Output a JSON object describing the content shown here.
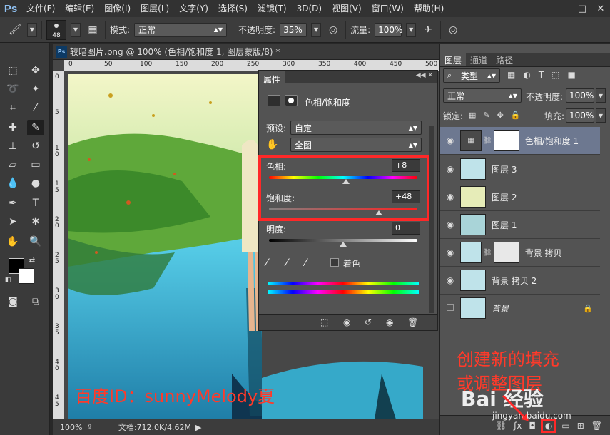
{
  "app": {
    "logo": "Ps"
  },
  "menu": [
    "文件(F)",
    "编辑(E)",
    "图像(I)",
    "图层(L)",
    "文字(Y)",
    "选择(S)",
    "滤镜(T)",
    "3D(D)",
    "视图(V)",
    "窗口(W)",
    "帮助(H)"
  ],
  "window_controls": {
    "minimize": "—",
    "maximize": "□",
    "close": "✕"
  },
  "options": {
    "brush_size": "48",
    "mode_label": "模式:",
    "mode_value": "正常",
    "opacity_label": "不透明度:",
    "opacity_value": "35%",
    "flow_label": "流量:",
    "flow_value": "100%"
  },
  "document": {
    "tab_title": "较暗图片.png @ 100% (色相/饱和度 1, 图层蒙版/8) *",
    "zoom": "100%",
    "doc_info": "文档:712.0K/4.62M",
    "ruler_top": [
      "0",
      "50",
      "100",
      "150",
      "200",
      "250",
      "300",
      "350",
      "400",
      "450",
      "500"
    ],
    "ruler_left": [
      "0",
      "5",
      "1 0",
      "1 5",
      "2 0",
      "2 5",
      "3 0",
      "3 5",
      "4 0",
      "4 5"
    ]
  },
  "properties": {
    "panel_title": "属性",
    "adjustment_name": "色相/饱和度",
    "preset_label": "预设:",
    "preset_value": "自定",
    "channel_value": "全图",
    "hue_label": "色相:",
    "hue_value": "+8",
    "hue_level": 0.52,
    "saturation_label": "饱和度:",
    "saturation_value": "+48",
    "saturation_level": 0.74,
    "lightness_label": "明度:",
    "lightness_value": "0",
    "lightness_level": 0.5,
    "colorize_label": "着色"
  },
  "layers_panel": {
    "tabs": [
      "图层",
      "通道",
      "路径"
    ],
    "filter_value": "类型",
    "blend_mode": "正常",
    "opacity_label": "不透明度:",
    "opacity_value": "100%",
    "lock_label": "锁定:",
    "fill_label": "填充:",
    "fill_value": "100%",
    "layers": [
      {
        "name": "色相/饱和度 1",
        "selected": true
      },
      {
        "name": "图层 3"
      },
      {
        "name": "图层 2"
      },
      {
        "name": "图层 1"
      },
      {
        "name": "背景 拷贝"
      },
      {
        "name": "背景 拷贝 2"
      },
      {
        "name": "背景"
      }
    ]
  },
  "annotations": {
    "watermark_text": "百度ID：sunnyMelody夏",
    "callout_line1": "创建新的填充",
    "callout_line2": "或调整图层",
    "baidu_logo": "Bai 经验",
    "baidu_url": "jingyan.baidu.com"
  },
  "colors": {
    "highlight": "#ff2828",
    "selected_layer": "#6d7890"
  }
}
